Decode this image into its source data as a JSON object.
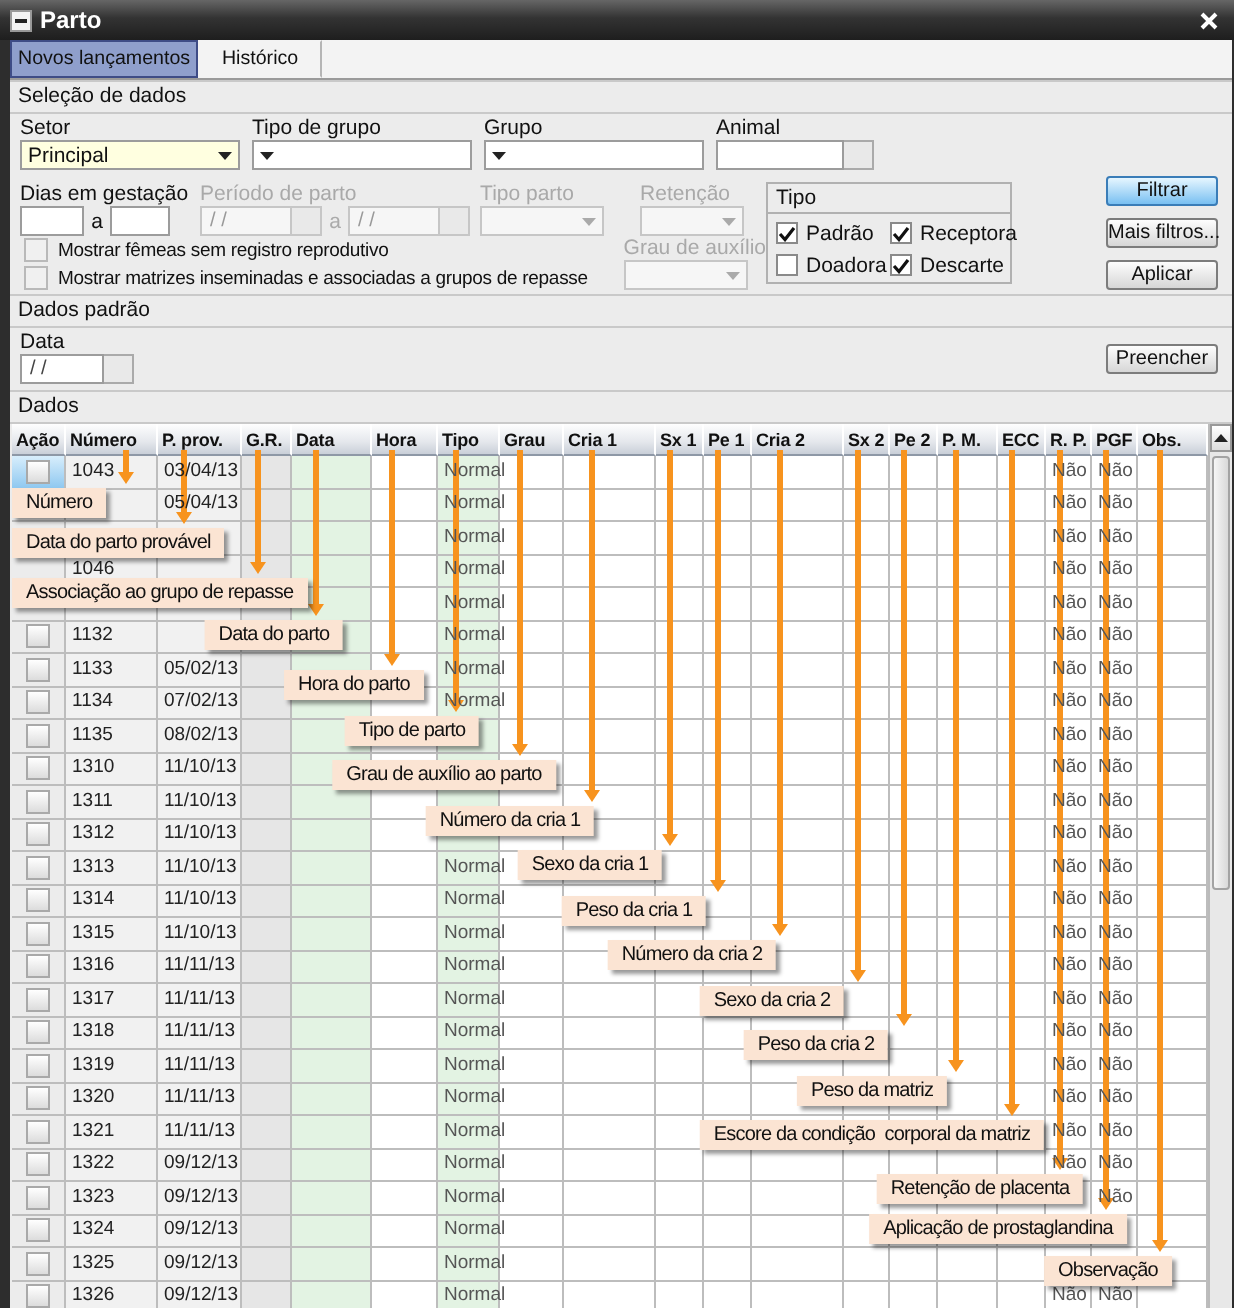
{
  "window": {
    "title": "Parto"
  },
  "tabs": [
    {
      "label": "Novos lançamentos",
      "selected": true
    },
    {
      "label": "Histórico",
      "selected": false
    }
  ],
  "selection": {
    "title": "Seleção de dados",
    "fields": [
      {
        "kind": "dropdown",
        "label": "Setor",
        "value": "Principal",
        "required": true
      },
      {
        "kind": "dropdown",
        "label": "Tipo de grupo",
        "required": false
      },
      {
        "kind": "dropdown",
        "label": "Grupo",
        "required": false
      },
      {
        "kind": "lookup",
        "label": "Animal",
        "required": false
      }
    ],
    "ranges": [
      {
        "kind": "number",
        "label": "Dias em gestação",
        "separator": "a",
        "disabled": false
      },
      {
        "kind": "date",
        "label": "Período de parto",
        "separator": "a",
        "from": "/ /",
        "to": "/ /",
        "disabled": true
      }
    ],
    "selects": [
      {
        "label": "Tipo parto",
        "disabled": true
      },
      {
        "label": "Retenção",
        "disabled": true
      }
    ],
    "checkboxes": [
      {
        "label": "Mostrar fêmeas sem registro reprodutivo",
        "checked": false
      },
      {
        "label": "Mostrar matrizes inseminadas e associadas a grupos de repasse",
        "checked": false
      }
    ],
    "grau": {
      "label": "Grau de auxílio",
      "disabled": true
    },
    "tipo": {
      "title": "Tipo",
      "options": [
        {
          "label": "Padrão",
          "checked": true
        },
        {
          "label": "Receptora",
          "checked": true
        },
        {
          "label": "Doadora",
          "checked": false
        },
        {
          "label": "Descarte",
          "checked": true
        }
      ]
    },
    "buttons": [
      {
        "label": "Filtrar",
        "kind": "default"
      },
      {
        "label": "Mais filtros...",
        "kind": "normal"
      },
      {
        "label": "Aplicar",
        "kind": "normal"
      }
    ]
  },
  "defaults": {
    "title": "Dados padrão",
    "label": "Data",
    "value": "/ /",
    "button": "Preencher"
  },
  "table": {
    "title": "Dados",
    "columns": [
      {
        "label": "Ação"
      },
      {
        "label": "Número",
        "callout": "Número"
      },
      {
        "label": "P. prov.",
        "callout": "Data do parto provável"
      },
      {
        "label": "G.R.",
        "callout": "Associação ao grupo de repasse"
      },
      {
        "label": "Data",
        "callout": "Data do parto"
      },
      {
        "label": "Hora",
        "callout": "Hora do parto"
      },
      {
        "label": "Tipo",
        "callout": "Tipo de parto"
      },
      {
        "label": "Grau",
        "callout": "Grau de auxílio ao parto"
      },
      {
        "label": "Cria 1",
        "callout": "Número da cria 1"
      },
      {
        "label": "Sx 1",
        "callout": "Sexo da cria 1"
      },
      {
        "label": "Pe 1",
        "callout": "Peso da cria 1"
      },
      {
        "label": "Cria 2",
        "callout": "Número da cria 2"
      },
      {
        "label": "Sx 2",
        "callout": "Sexo da cria 2"
      },
      {
        "label": "Pe 2",
        "callout": "Peso da cria 2"
      },
      {
        "label": "P. M.",
        "callout": "Peso da matriz"
      },
      {
        "label": "ECC",
        "callout": "Escore da condição  corporal da matriz"
      },
      {
        "label": "R. P.",
        "callout": "Retenção de placenta"
      },
      {
        "label": "PGF",
        "callout": "Aplicação de prostaglandina"
      },
      {
        "label": "Obs.",
        "callout": "Observação"
      }
    ],
    "rows": [
      {
        "checked": false,
        "selected": true,
        "numero": "1043",
        "p_prov": "03/04/13",
        "tipo": "Normal",
        "r_p": "Não",
        "pgf": "Não"
      },
      {
        "p_prov": "05/04/13",
        "tipo": "Normal",
        "r_p": "Não",
        "pgf": "Não"
      },
      {
        "tipo": "Normal",
        "r_p": "Não",
        "pgf": "Não"
      },
      {
        "numero": "1046",
        "tipo": "Normal",
        "r_p": "Não",
        "pgf": "Não"
      },
      {
        "tipo": "Normal",
        "r_p": "Não",
        "pgf": "Não"
      },
      {
        "checked": false,
        "selected": false,
        "numero": "1132",
        "tipo": "Normal",
        "r_p": "Não",
        "pgf": "Não"
      },
      {
        "checked": false,
        "selected": false,
        "numero": "1133",
        "p_prov": "05/02/13",
        "tipo": "Normal",
        "r_p": "Não",
        "pgf": "Não"
      },
      {
        "checked": false,
        "selected": false,
        "numero": "1134",
        "p_prov": "07/02/13",
        "tipo": "Normal",
        "r_p": "Não",
        "pgf": "Não"
      },
      {
        "checked": false,
        "selected": false,
        "numero": "1135",
        "p_prov": "08/02/13",
        "r_p": "Não",
        "pgf": "Não"
      },
      {
        "checked": false,
        "selected": false,
        "numero": "1310",
        "p_prov": "11/10/13",
        "r_p": "Não",
        "pgf": "Não"
      },
      {
        "checked": false,
        "selected": false,
        "numero": "1311",
        "p_prov": "11/10/13",
        "r_p": "Não",
        "pgf": "Não"
      },
      {
        "checked": false,
        "selected": false,
        "numero": "1312",
        "p_prov": "11/10/13",
        "r_p": "Não",
        "pgf": "Não"
      },
      {
        "checked": false,
        "selected": false,
        "numero": "1313",
        "p_prov": "11/10/13",
        "tipo": "Normal",
        "r_p": "Não",
        "pgf": "Não"
      },
      {
        "checked": false,
        "selected": false,
        "numero": "1314",
        "p_prov": "11/10/13",
        "tipo": "Normal",
        "r_p": "Não",
        "pgf": "Não"
      },
      {
        "checked": false,
        "selected": false,
        "numero": "1315",
        "p_prov": "11/10/13",
        "tipo": "Normal",
        "r_p": "Não",
        "pgf": "Não"
      },
      {
        "checked": false,
        "selected": false,
        "numero": "1316",
        "p_prov": "11/11/13",
        "tipo": "Normal",
        "r_p": "Não",
        "pgf": "Não"
      },
      {
        "checked": false,
        "selected": false,
        "numero": "1317",
        "p_prov": "11/11/13",
        "tipo": "Normal",
        "r_p": "Não",
        "pgf": "Não"
      },
      {
        "checked": false,
        "selected": false,
        "numero": "1318",
        "p_prov": "11/11/13",
        "tipo": "Normal",
        "r_p": "Não",
        "pgf": "Não"
      },
      {
        "checked": false,
        "selected": false,
        "numero": "1319",
        "p_prov": "11/11/13",
        "tipo": "Normal",
        "r_p": "Não",
        "pgf": "Não"
      },
      {
        "checked": false,
        "selected": false,
        "numero": "1320",
        "p_prov": "11/11/13",
        "tipo": "Normal",
        "r_p": "Não",
        "pgf": "Não"
      },
      {
        "checked": false,
        "selected": false,
        "numero": "1321",
        "p_prov": "11/11/13",
        "tipo": "Normal",
        "r_p": "Não",
        "pgf": "Não"
      },
      {
        "checked": false,
        "selected": false,
        "numero": "1322",
        "p_prov": "09/12/13",
        "tipo": "Normal",
        "r_p": "Não",
        "pgf": "Não"
      },
      {
        "checked": false,
        "selected": false,
        "numero": "1323",
        "p_prov": "09/12/13",
        "tipo": "Normal",
        "pgf": "Não"
      },
      {
        "checked": false,
        "selected": false,
        "numero": "1324",
        "p_prov": "09/12/13",
        "tipo": "Normal"
      },
      {
        "checked": false,
        "selected": false,
        "numero": "1325",
        "p_prov": "09/12/13",
        "tipo": "Normal"
      },
      {
        "checked": false,
        "selected": false,
        "numero": "1326",
        "p_prov": "09/12/13",
        "tipo": "Normal",
        "r_p": "Não",
        "pgf": "Não"
      }
    ]
  }
}
